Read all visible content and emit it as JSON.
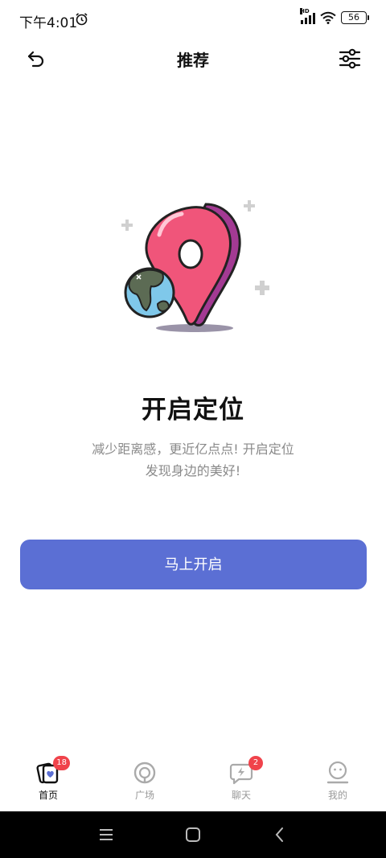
{
  "status_bar": {
    "time": "下午4:01",
    "network_type": "HD",
    "battery": "56"
  },
  "header": {
    "title": "推荐"
  },
  "content": {
    "title": "开启定位",
    "description_line1": "减少距离感，更近亿点点! 开启定位",
    "description_line2": "发现身边的美好!",
    "button_label": "马上开启"
  },
  "bottom_nav": {
    "items": [
      {
        "label": "首页",
        "badge": "18",
        "active": true
      },
      {
        "label": "广场",
        "badge": "",
        "active": false
      },
      {
        "label": "聊天",
        "badge": "2",
        "active": false
      },
      {
        "label": "我的",
        "badge": "",
        "active": false
      }
    ]
  },
  "colors": {
    "accent": "#5b6fd4",
    "badge": "#f0434b",
    "pin_pink": "#f0557a",
    "pin_purple": "#a33a93"
  }
}
